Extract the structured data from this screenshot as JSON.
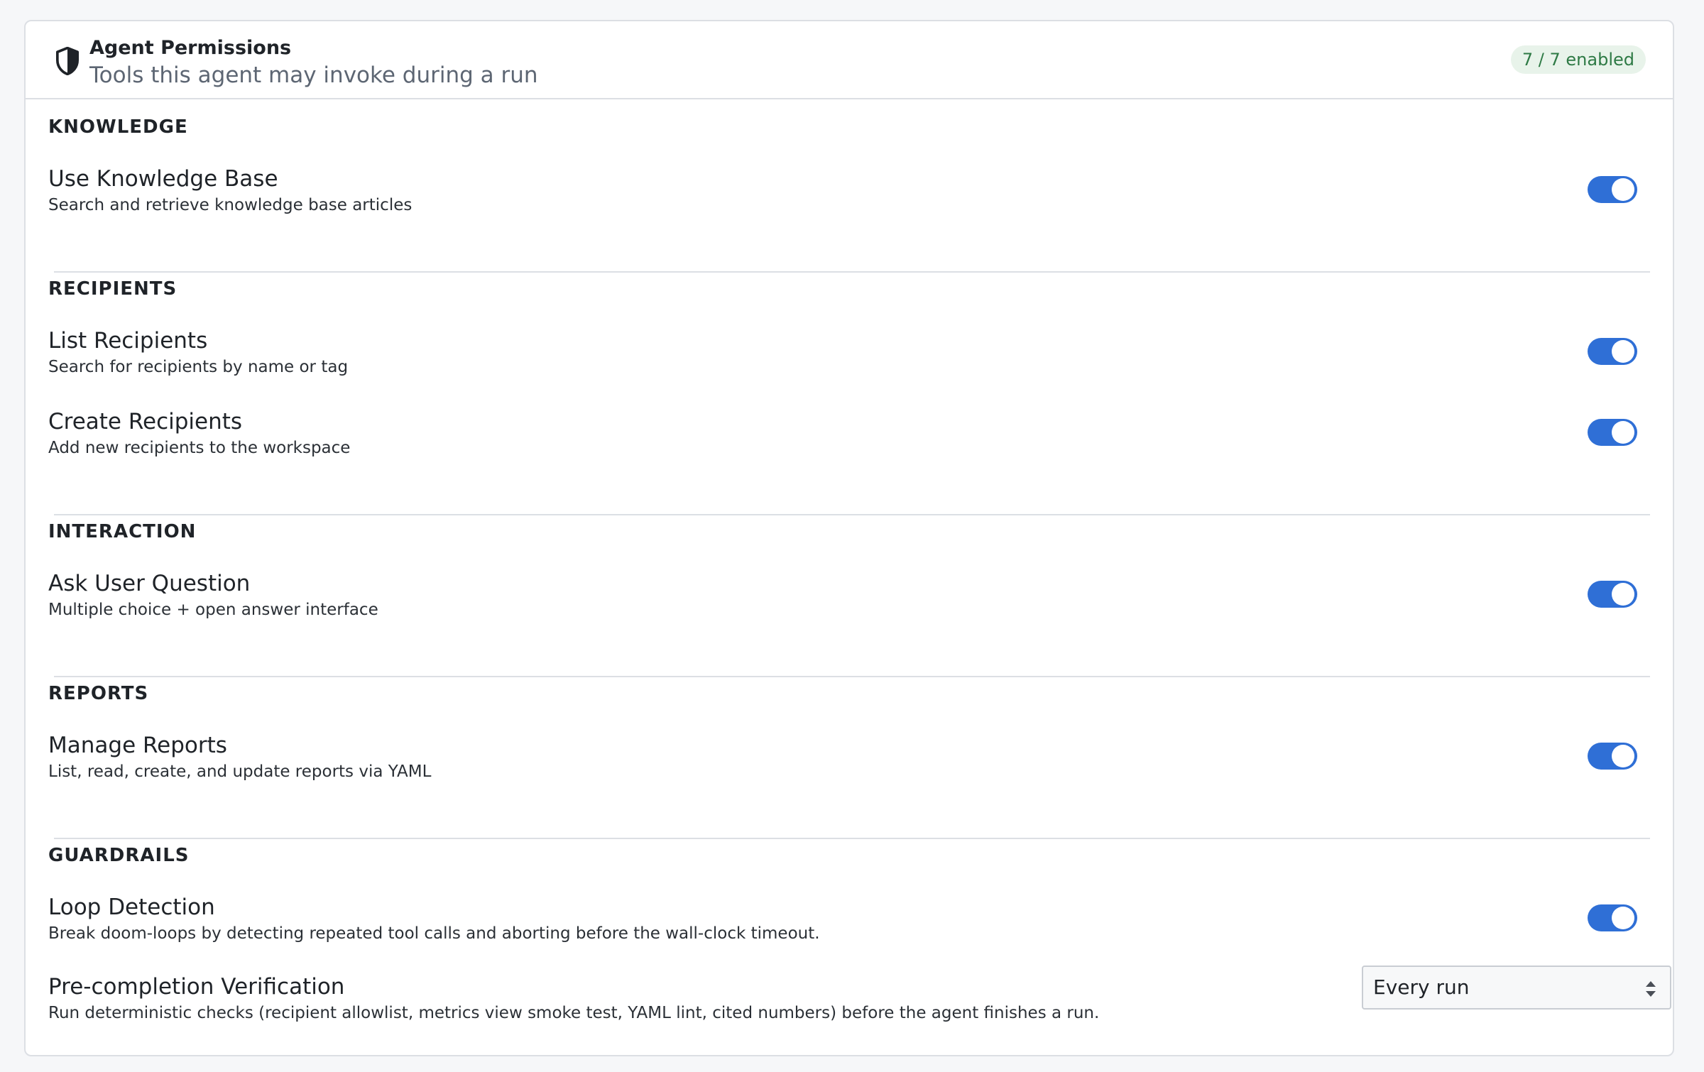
{
  "header": {
    "title": "Agent Permissions",
    "subtitle": "Tools this agent may invoke during a run",
    "badge": "7 / 7 enabled",
    "icon": "shield-icon"
  },
  "sections": [
    {
      "title": "KNOWLEDGE",
      "items": [
        {
          "title": "Use Knowledge Base",
          "description": "Search and retrieve knowledge base articles",
          "enabled": true
        }
      ]
    },
    {
      "title": "RECIPIENTS",
      "items": [
        {
          "title": "List Recipients",
          "description": "Search for recipients by name or tag",
          "enabled": true
        },
        {
          "title": "Create Recipients",
          "description": "Add new recipients to the workspace",
          "enabled": true
        }
      ]
    },
    {
      "title": "INTERACTION",
      "items": [
        {
          "title": "Ask User Question",
          "description": "Multiple choice + open answer interface",
          "enabled": true
        }
      ]
    },
    {
      "title": "REPORTS",
      "items": [
        {
          "title": "Manage Reports",
          "description": "List, read, create, and update reports via YAML",
          "enabled": true
        }
      ]
    },
    {
      "title": "GUARDRAILS",
      "items": [
        {
          "title": "Loop Detection",
          "description": "Break doom-loops by detecting repeated tool calls and aborting before the wall-clock timeout.",
          "enabled": true
        },
        {
          "title": "Pre-completion Verification",
          "description": "Run deterministic checks (recipient allowlist, metrics view smoke test, YAML lint, cited numbers) before the agent finishes a run.",
          "select_value": "Every run"
        }
      ]
    }
  ],
  "colors": {
    "toggle_on": "#2f6fd6",
    "badge_bg": "#e8f3ea",
    "badge_text": "#2e7a45"
  }
}
